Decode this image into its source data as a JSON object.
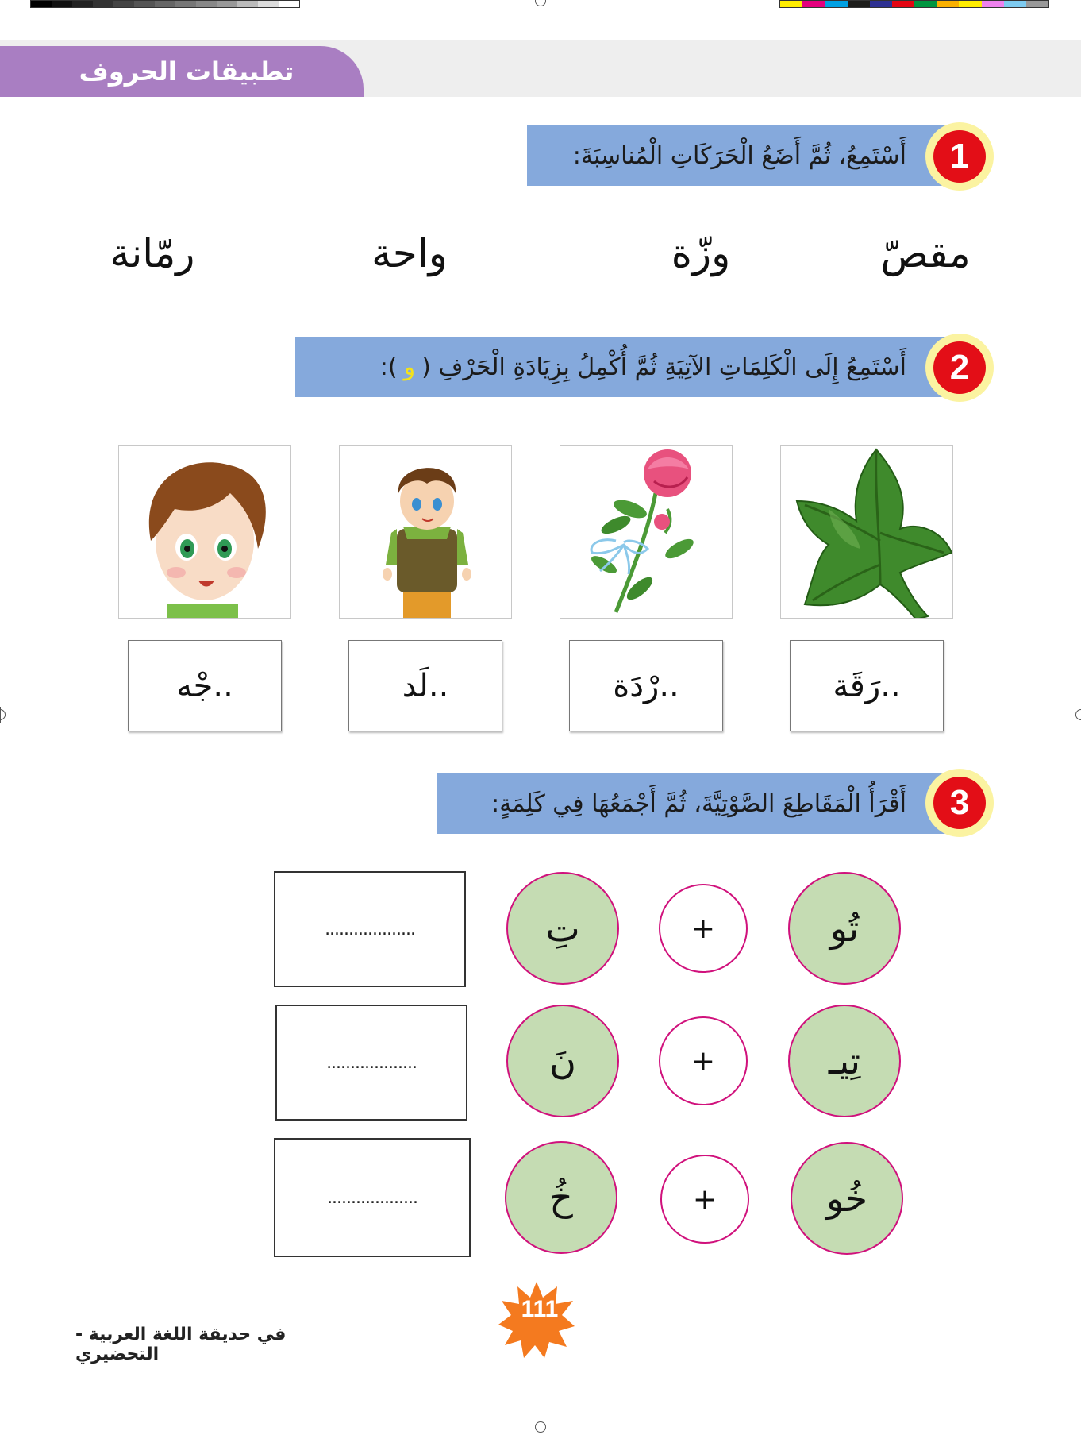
{
  "header": {
    "title": "تطبيقات الحروف"
  },
  "exercise1": {
    "number": "1",
    "instruction": "أَسْتَمِعُ، ثُمَّ أَضَعُ الْحَرَكَاتِ الْمُناسِبَةَ:",
    "words": [
      "مقصّ",
      "وزّة",
      "واحة",
      "رمّانة"
    ]
  },
  "exercise2": {
    "number": "2",
    "instruction": "أَسْتَمِعُ إِلَى الْكَلِمَاتِ الآتِيَةِ ثُمَّ أُكْمِلُ بِزِيَادَةِ الْحَرْفِ (",
    "letter": "و",
    "instruction_end": "):",
    "items": [
      {
        "picture": "leaf-image",
        "word": "..رَقَة"
      },
      {
        "picture": "rose-image",
        "word": "..رْدَة"
      },
      {
        "picture": "boy-image",
        "word": "..لَد"
      },
      {
        "picture": "face-image",
        "word": "..جْه"
      }
    ]
  },
  "exercise3": {
    "number": "3",
    "instruction": "أَقْرَأُ الْمَقَاطِعَ الصَّوْتِيَّةَ، ثُمَّ أَجْمَعُهَا فِي كَلِمَةٍ:",
    "plus": "+",
    "rows": [
      {
        "first": "تُو",
        "second": "تِ",
        "answer": "..................."
      },
      {
        "first": "تِيـ",
        "second": "نَ",
        "answer": "..................."
      },
      {
        "first": "خُو",
        "second": "خُ",
        "answer": "..................."
      }
    ]
  },
  "footer": {
    "book": "في حديقة اللغة العربية - التحضيري",
    "page": "111"
  },
  "colors": {
    "header_tab": "#a97ec2",
    "banner": "#85a9dc",
    "badge": "#e30e17",
    "syllable": "#c5dcb3",
    "ring": "#d0117c",
    "page_star": "#f47a1f"
  }
}
